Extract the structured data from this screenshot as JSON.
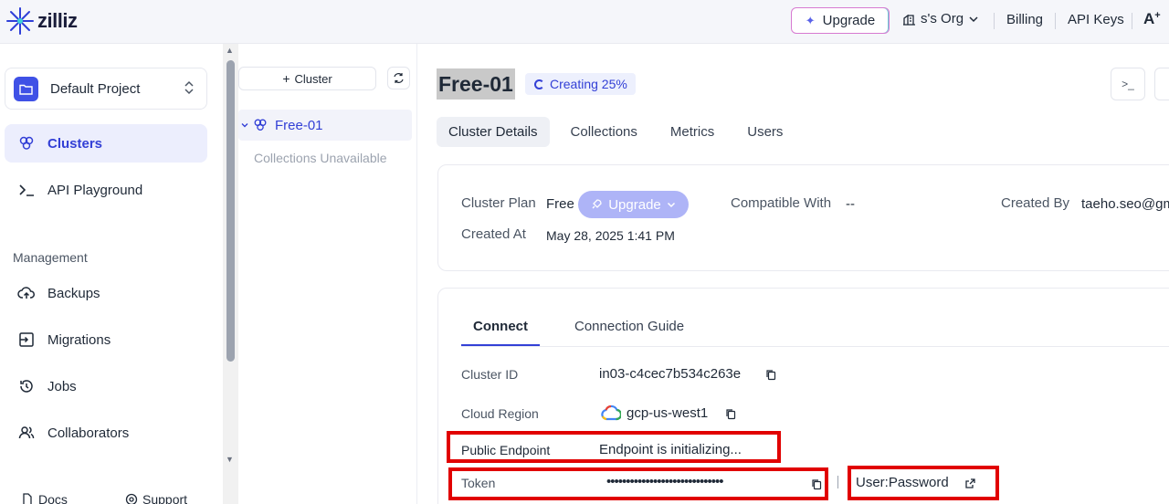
{
  "topbar": {
    "logo_text": "zilliz",
    "upgrade_label": "Upgrade",
    "org_label": "s's Org",
    "billing_label": "Billing",
    "api_keys_label": "API Keys",
    "text_size_label": "A"
  },
  "sidebar": {
    "project_name": "Default Project",
    "items": [
      {
        "label": "Clusters",
        "icon": "clusters-icon",
        "active": true
      },
      {
        "label": "API Playground",
        "icon": "terminal-icon"
      }
    ],
    "section_label": "Management",
    "management_items": [
      {
        "label": "Backups",
        "icon": "cloud-upload-icon"
      },
      {
        "label": "Migrations",
        "icon": "migration-icon"
      },
      {
        "label": "Jobs",
        "icon": "history-icon"
      },
      {
        "label": "Collaborators",
        "icon": "users-icon"
      }
    ],
    "docs_label": "Docs",
    "support_label": "Support"
  },
  "tree": {
    "add_cluster_label": "Cluster",
    "cluster_name": "Free-01",
    "sub_label": "Collections Unavailable"
  },
  "main": {
    "cluster_name": "Free-01",
    "status": "Creating 25%",
    "tabs": [
      "Cluster Details",
      "Collections",
      "Metrics",
      "Users"
    ],
    "details": {
      "plan_label": "Cluster Plan",
      "plan_value": "Free",
      "upgrade_label": "Upgrade",
      "compatible_label": "Compatible With",
      "compatible_value": "--",
      "created_by_label": "Created By",
      "created_by_value": "taeho.seo@gm",
      "created_at_label": "Created At",
      "created_at_value": "May 28, 2025 1:41 PM"
    },
    "connect": {
      "tabs": [
        "Connect",
        "Connection Guide"
      ],
      "cluster_id_label": "Cluster ID",
      "cluster_id_value": "in03-c4cec7b534c263e",
      "region_label": "Cloud Region",
      "region_value": "gcp-us-west1",
      "endpoint_label": "Public Endpoint",
      "endpoint_value": "Endpoint is initializing...",
      "token_label": "Token",
      "token_value": "••••••••••••••••••••••••••••••",
      "user_password_label": "User:Password"
    }
  },
  "colors": {
    "accent": "#3340d6",
    "highlight_box": "#e10000",
    "upgrade_pill": "#aeb4f7"
  }
}
